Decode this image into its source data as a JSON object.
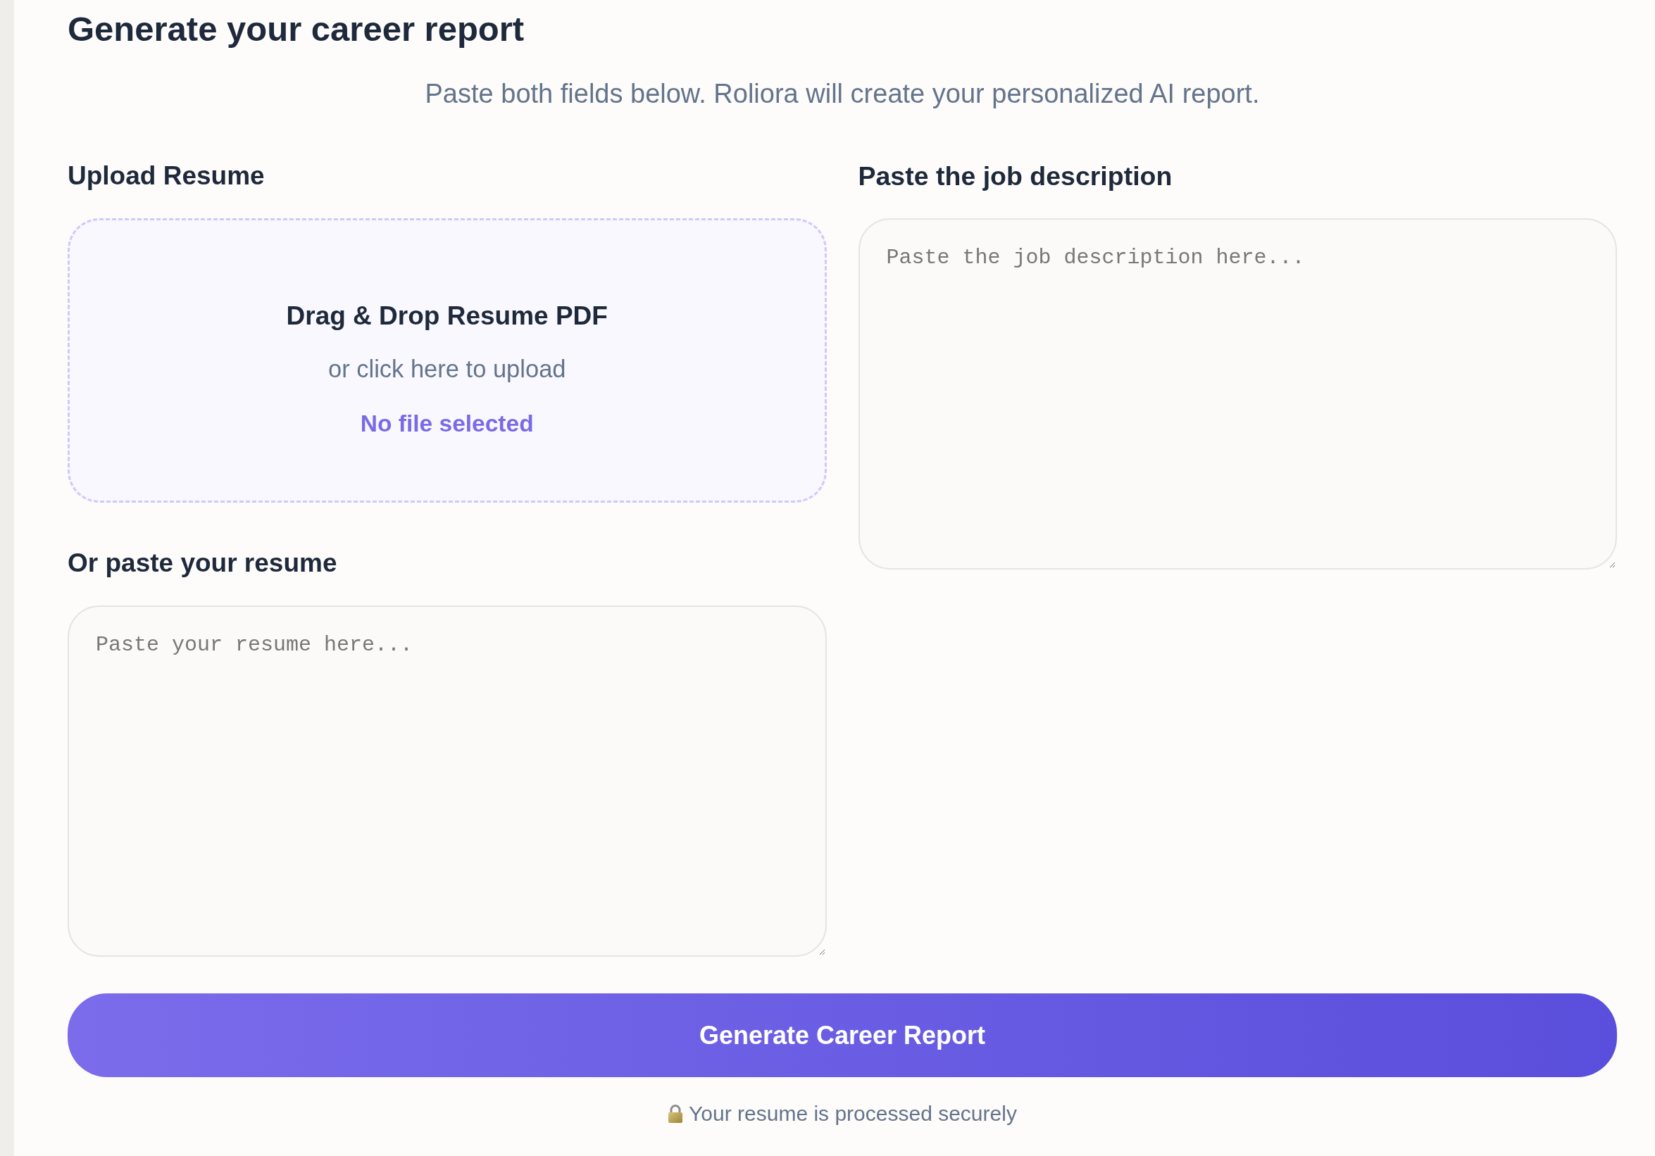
{
  "page": {
    "title": "Generate your career report",
    "subtitle": "Paste both fields below. Roliora will create your personalized AI report."
  },
  "upload": {
    "label": "Upload Resume",
    "dropzone": {
      "heading": "Drag & Drop Resume PDF",
      "hint": "or click here to upload",
      "file_status": "No file selected"
    }
  },
  "resume_text": {
    "label": "Or paste your resume",
    "placeholder": "Paste your resume here..."
  },
  "job_description": {
    "label": "Paste the job description",
    "placeholder": "Paste the job description here..."
  },
  "submit_button": {
    "label": "Generate Career Report"
  },
  "security_note": {
    "text": "Your resume is processed securely"
  }
}
